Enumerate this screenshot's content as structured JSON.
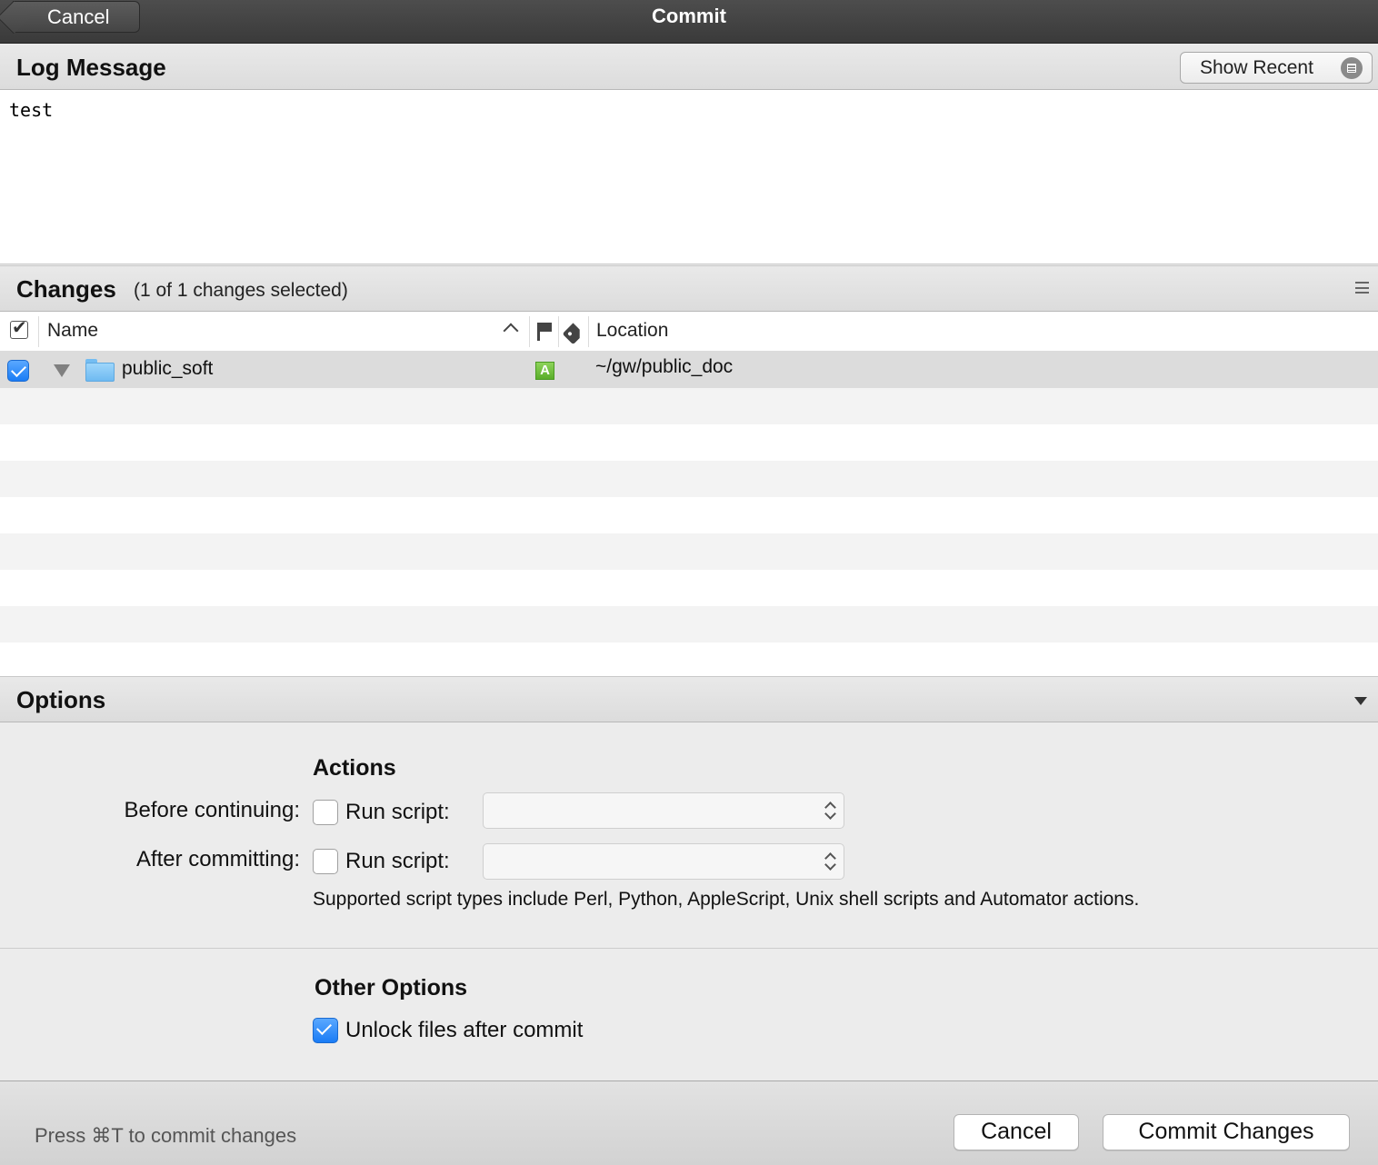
{
  "titlebar": {
    "title": "Commit",
    "back_label": "Cancel"
  },
  "log_message": {
    "title": "Log Message",
    "show_recent_label": "Show Recent",
    "text": "test"
  },
  "changes": {
    "title": "Changes",
    "count_text": "(1 of 1 changes selected)",
    "columns": {
      "name": "Name",
      "location": "Location"
    },
    "rows": [
      {
        "name": "public_soft",
        "status": "A",
        "location": "~/gw/public_doc",
        "checked": true,
        "status_color": "#5aae2a"
      }
    ]
  },
  "options": {
    "title": "Options",
    "actions_heading": "Actions",
    "before_label": "Before continuing:",
    "after_label": "After committing:",
    "run_script_label": "Run script:",
    "hint": "Supported script types include Perl, Python, AppleScript, Unix shell scripts and Automator actions.",
    "other_heading": "Other Options",
    "unlock_label": "Unlock files after commit",
    "unlock_checked": true,
    "before_run_script_checked": false,
    "after_run_script_checked": false
  },
  "footer": {
    "hint": "Press ⌘T to commit changes",
    "cancel_label": "Cancel",
    "commit_label": "Commit Changes"
  },
  "colors": {
    "accent": "#1a7cf5",
    "titlebar": "#3a3a3a"
  }
}
